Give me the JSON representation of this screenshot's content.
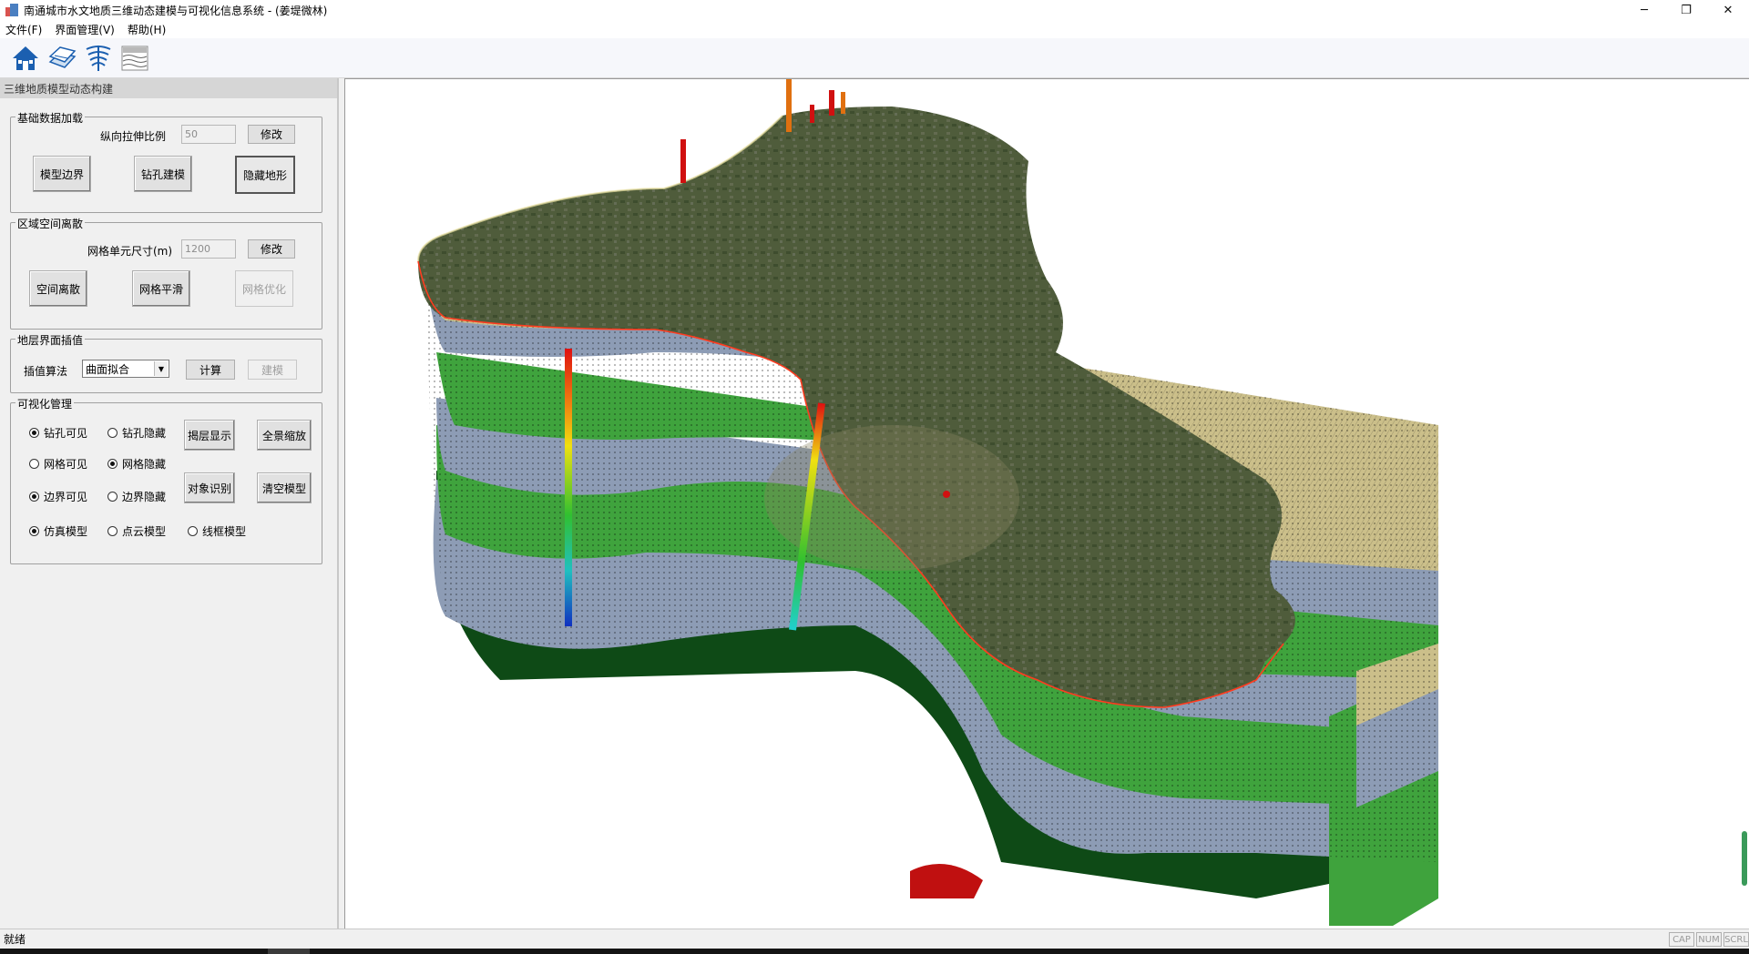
{
  "window": {
    "title": "南通城市水文地质三维动态建模与可视化信息系统 - (姜堤微林)",
    "controls": {
      "minimize": "─",
      "restore": "❐",
      "close": "✕"
    }
  },
  "menu": {
    "items": [
      "文件(F)",
      "界面管理(V)",
      "帮助(H)"
    ]
  },
  "toolbar": {
    "buttons": [
      "home-icon",
      "layers-icon",
      "boreholes-icon",
      "strata-icon"
    ]
  },
  "panel": {
    "title": "三维地质模型动态构建",
    "basic": {
      "legend": "基础数据加载",
      "stretch_label": "纵向拉伸比例",
      "stretch_value": "50",
      "modify": "修改",
      "btn_boundary": "模型边界",
      "btn_borehole": "钻孔建模",
      "btn_hide_terrain": "隐藏地形"
    },
    "discrete": {
      "legend": "区域空间离散",
      "cell_label": "网格单元尺寸(m)",
      "cell_value": "1200",
      "modify": "修改",
      "btn_discretize": "空间离散",
      "btn_smooth": "网格平滑",
      "btn_optimize": "网格优化"
    },
    "interp": {
      "legend": "地层界面插值",
      "algo_label": "插值算法",
      "algo_value": "曲面拟合",
      "btn_compute": "计算",
      "btn_build": "建模"
    },
    "vis": {
      "legend": "可视化管理",
      "r_borehole_show": "钻孔可见",
      "r_borehole_hide": "钻孔隐藏",
      "r_grid_show": "网格可见",
      "r_grid_hide": "网格隐藏",
      "r_boundary_show": "边界可见",
      "r_boundary_hide": "边界隐藏",
      "r_sim": "仿真模型",
      "r_cloud": "点云模型",
      "r_wire": "线框模型",
      "btn_peel": "揭层显示",
      "btn_zoom": "全景缩放",
      "btn_identify": "对象识别",
      "btn_clear": "清空模型"
    }
  },
  "status": {
    "text": "就绪",
    "indicators": [
      "CAP",
      "NUM",
      "SCRL"
    ]
  },
  "colors": {
    "terrain": "#4d5a3a",
    "tan_layer": "#cbbf8a",
    "blue_layer": "#8d9cb5",
    "green_layer": "#3fa33d",
    "dark_green": "#0e4a16",
    "boundary_line": "#ff3b1f"
  }
}
